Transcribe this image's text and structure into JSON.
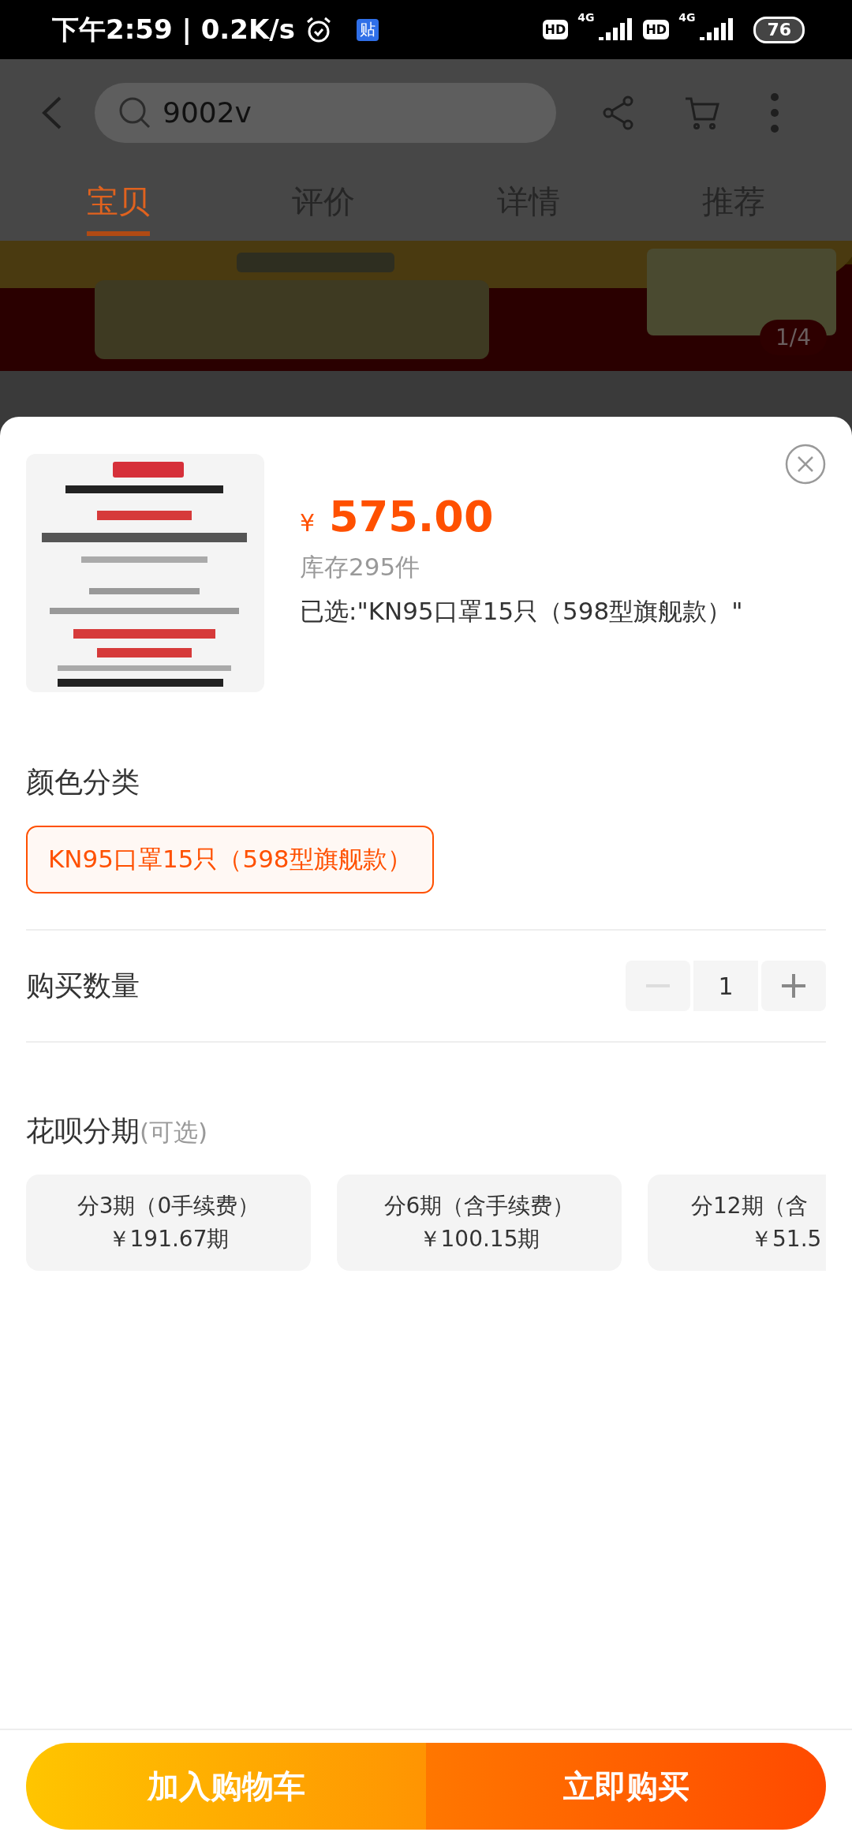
{
  "status_bar": {
    "time": "下午2:59 | 0.2K/s",
    "notification": "贴",
    "sims": [
      {
        "hd": "HD",
        "network": "4G"
      },
      {
        "hd": "HD",
        "network": "4G"
      }
    ],
    "battery": "76"
  },
  "header": {
    "search": {
      "value": "9002v"
    }
  },
  "tabs": [
    {
      "label": "宝贝",
      "selected": true
    },
    {
      "label": "评价",
      "selected": false
    },
    {
      "label": "详情",
      "selected": false
    },
    {
      "label": "推荐",
      "selected": false
    }
  ],
  "banner": {
    "kind": "picture",
    "counter": "1/4"
  },
  "sheet": {
    "currency": "¥",
    "price": "575.00",
    "stock": "库存295件",
    "selected_text": "已选:\"KN95口罩15只（598型旗舰款）\"",
    "color_section": {
      "title": "颜色分类",
      "options": [
        {
          "label": "KN95口罩15只（598型旗舰款）",
          "selected": true
        }
      ]
    },
    "quantity": {
      "title": "购买数量",
      "value": "1",
      "minus_disabled": true
    },
    "installments": {
      "title": "花呗分期",
      "hint": "(可选)",
      "plans": [
        {
          "kind": "full",
          "label": "分3期（0手续费）",
          "amount": "￥191.67期"
        },
        {
          "kind": "full",
          "label": "分6期（含手续费）",
          "amount": "￥100.15期"
        },
        {
          "kind": "cut",
          "label": "分12期（含",
          "amount": "￥51.5"
        }
      ]
    }
  },
  "actions": [
    {
      "kind": "cart",
      "label": "加入购物车"
    },
    {
      "kind": "buy",
      "label": "立即购买"
    }
  ]
}
